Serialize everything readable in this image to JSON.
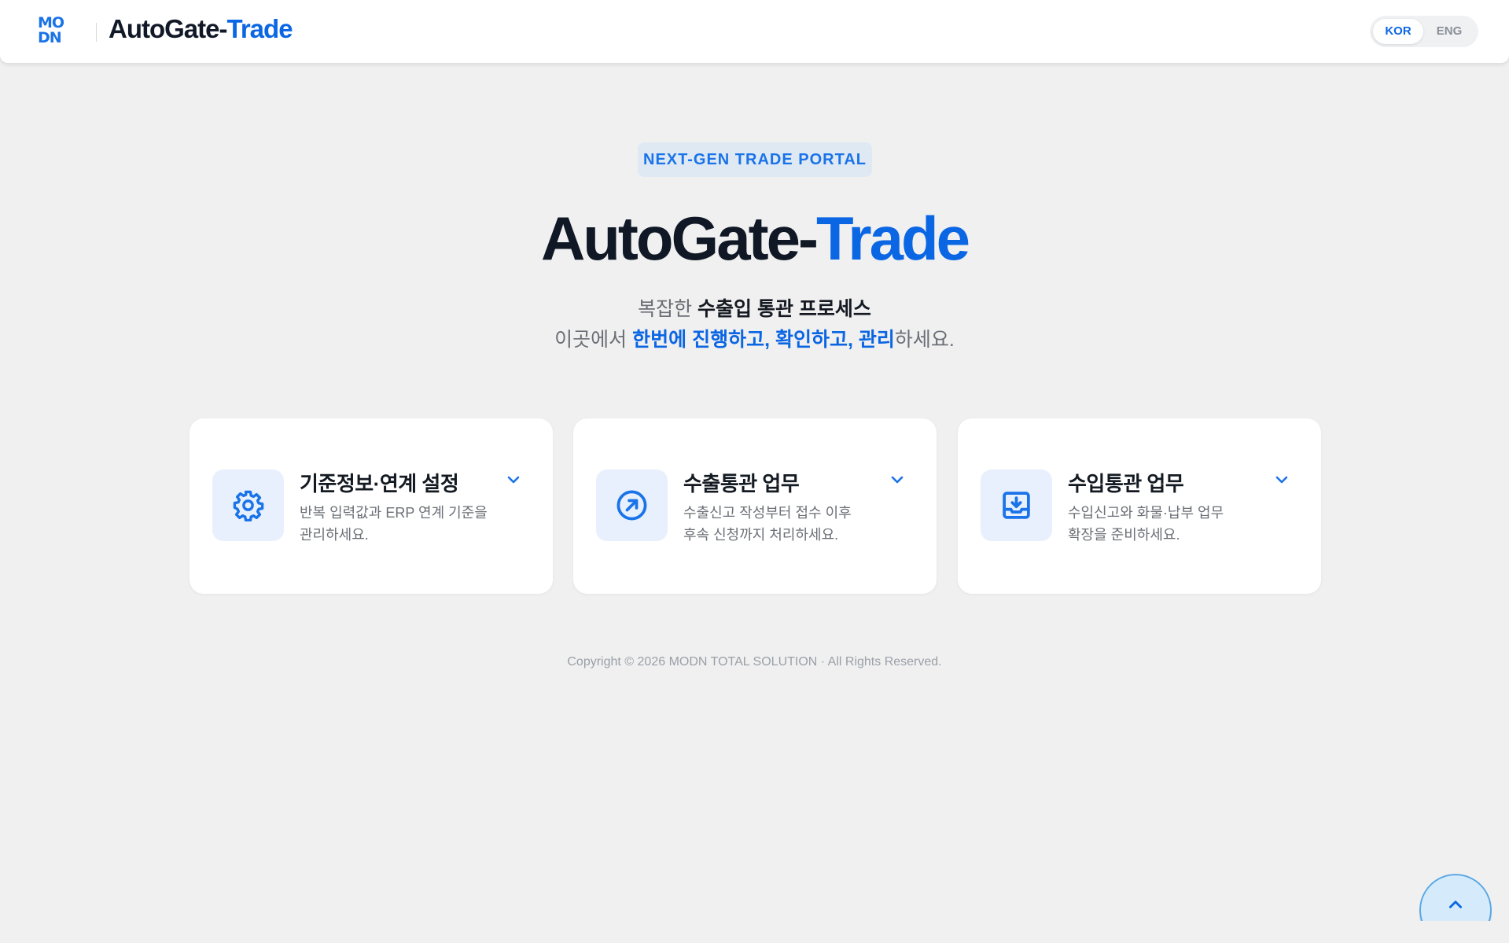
{
  "header": {
    "logo_line1": "MO",
    "logo_line2": "DN",
    "title_dark": "AutoGate-",
    "title_blue": "Trade",
    "lang": {
      "kor": "KOR",
      "eng": "ENG",
      "selected": "KOR"
    }
  },
  "hero": {
    "badge": "NEXT-GEN TRADE PORTAL",
    "title_dark": "AutoGate-",
    "title_blue": "Trade",
    "line1_plain": "복잡한 ",
    "line1_strong": "수출입 통관 프로세스",
    "line2_plain_start": "이곳에서 ",
    "line2_strong": "한번에 진행하고, 확인하고, 관리",
    "line2_plain_end": "하세요."
  },
  "cards": [
    {
      "title": "기준정보·연계 설정",
      "desc_line1": "반복 입력값과 ERP 연계 기준을",
      "desc_line2": "관리하세요.",
      "icon": "gear-icon"
    },
    {
      "title": "수출통관 업무",
      "desc_line1": "수출신고 작성부터 접수 이후",
      "desc_line2": "후속 신청까지 처리하세요.",
      "icon": "arrow-up-right-circle-icon"
    },
    {
      "title": "수입통관 업무",
      "desc_line1": "수입신고와 화물·납부 업무",
      "desc_line2": "확장을 준비하세요.",
      "icon": "inbox-download-icon"
    }
  ],
  "footer": {
    "copyright": "Copyright © 2026 MODN TOTAL SOLUTION · All Rights Reserved."
  },
  "colors": {
    "accent": "#0b66e4",
    "background": "#f0f0f0",
    "icon_bg": "#e7f0fc",
    "badge_bg": "#dfe9f4"
  }
}
